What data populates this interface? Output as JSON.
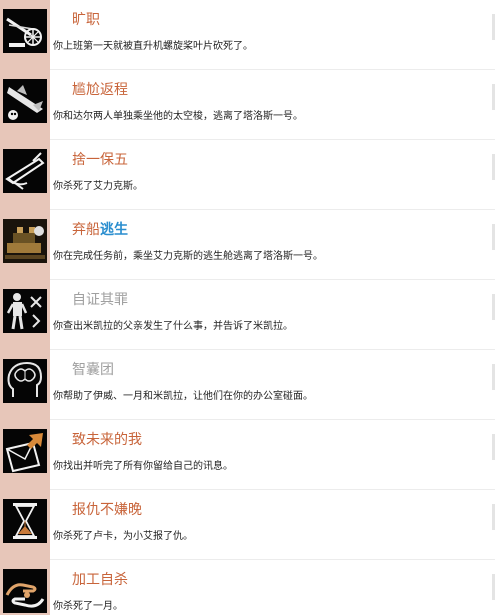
{
  "achievements": [
    {
      "title": "旷职",
      "desc": "你上班第一天就被直升机螺旋桨叶片砍死了。",
      "icon": "helicopter-rotor-icon"
    },
    {
      "title": "尴尬返程",
      "desc": "你和达尔两人单独乘坐他的太空梭，逃离了塔洛斯一号。",
      "icon": "space-shuttle-icon"
    },
    {
      "title": "捨一保五",
      "desc": "你杀死了艾力克斯。",
      "icon": "rifle-icon"
    },
    {
      "title": "弃船",
      "title_accent": "逃生",
      "desc": "你在完成任务前，乘坐艾力克斯的逃生舱逃离了塔洛斯一号。",
      "icon": "escape-pod-icon"
    },
    {
      "title": "自证其罪",
      "desc": "你查出米凯拉的父亲发生了什么事，并告诉了米凯拉。",
      "icon": "standing-figure-icon"
    },
    {
      "title": "智囊团",
      "desc": "你帮助了伊威、一月和米凯拉，让他们在你的办公室碰面。",
      "icon": "brain-head-icon"
    },
    {
      "title": "致未来的我",
      "desc": "你找出并听完了所有你留给自己的讯息。",
      "icon": "envelope-arrow-icon"
    },
    {
      "title": "报仇不嫌晚",
      "desc": "你杀死了卢卡，为小艾报了仇。",
      "icon": "hourglass-icon"
    },
    {
      "title": "加工自杀",
      "desc": "你杀死了一月。",
      "icon": "hands-icon"
    }
  ],
  "colors": {
    "title_unlocked": "#c8643a",
    "title_locked": "#a0a0a0",
    "title_accent": "#2a8ecf",
    "icon_frame": "#e7c6b9"
  }
}
